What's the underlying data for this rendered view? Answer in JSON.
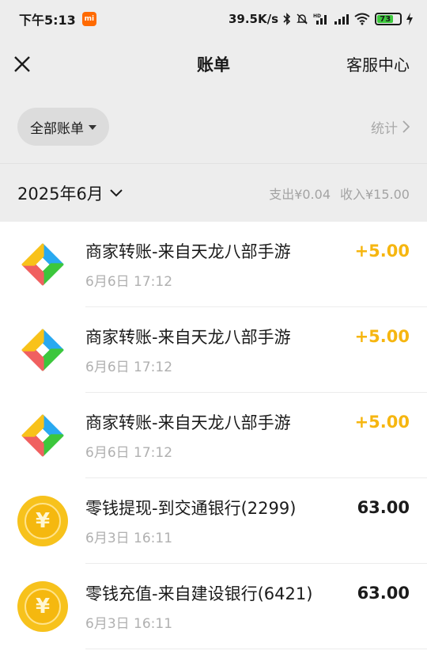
{
  "status_bar": {
    "time": "下午5:13",
    "brand_badge": "mi",
    "net_speed": "39.5K/s",
    "battery": "73"
  },
  "nav": {
    "title": "账单",
    "service": "客服中心"
  },
  "filter": {
    "all_bills": "全部账单",
    "stats": "统计"
  },
  "month": {
    "label": "2025年6月",
    "expense": "支出¥0.04",
    "income": "收入¥15.00"
  },
  "colors": {
    "income_amount": "#f6b610",
    "coin": "#f7c21c",
    "icon_blue": "#29a9f0",
    "icon_green": "#3cc73c",
    "icon_red": "#f06060",
    "icon_yellow": "#f8c21a"
  },
  "transactions": [
    {
      "icon": "merchant-quadrant-icon",
      "title": "商家转账-来自天龙八部手游",
      "time": "6月6日 17:12",
      "amount": "+5.00",
      "type": "income"
    },
    {
      "icon": "merchant-quadrant-icon",
      "title": "商家转账-来自天龙八部手游",
      "time": "6月6日 17:12",
      "amount": "+5.00",
      "type": "income"
    },
    {
      "icon": "merchant-quadrant-icon",
      "title": "商家转账-来自天龙八部手游",
      "time": "6月6日 17:12",
      "amount": "+5.00",
      "type": "income"
    },
    {
      "icon": "yuan-coin-icon",
      "title": "零钱提现-到交通银行(2299)",
      "time": "6月3日 16:11",
      "amount": "63.00",
      "type": "normal",
      "symbol": "¥"
    },
    {
      "icon": "yuan-coin-icon",
      "title": "零钱充值-来自建设银行(6421)",
      "time": "6月3日 16:11",
      "amount": "63.00",
      "type": "normal",
      "symbol": "¥"
    }
  ]
}
